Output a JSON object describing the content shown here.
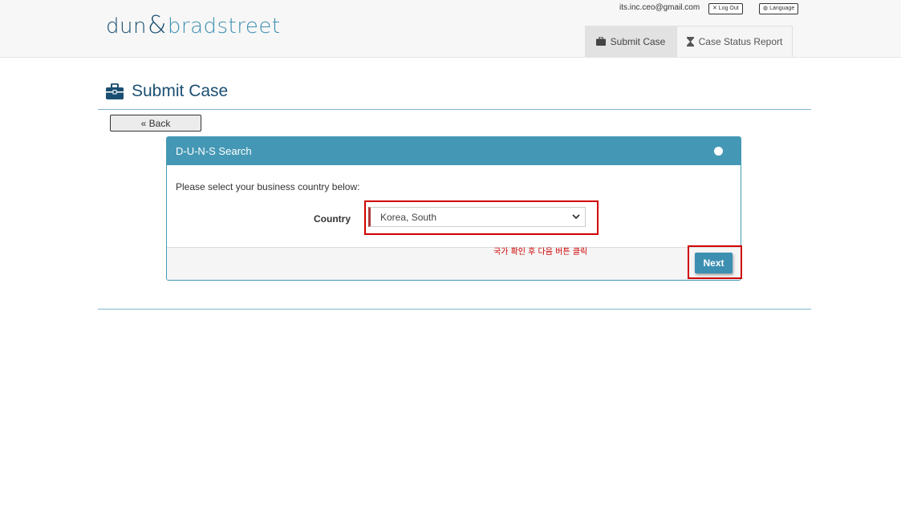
{
  "header": {
    "logo_dun": "dun",
    "logo_amp": "&",
    "logo_bradstreet": "bradstreet",
    "user_email": "its.inc.ceo@gmail.com",
    "logout_label": "✕ Log Out",
    "language_label": "Language",
    "tabs": [
      {
        "label": "Submit Case",
        "icon": "briefcase-icon",
        "active": true
      },
      {
        "label": "Case Status Report",
        "icon": "hourglass-icon",
        "active": false
      }
    ]
  },
  "page": {
    "title": "Submit Case",
    "back_label": "« Back"
  },
  "panel": {
    "title": "D-U-N-S Search",
    "prompt": "Please select your business country below:",
    "country_label": "Country",
    "country_value": "Korea, South",
    "next_label": "Next"
  },
  "annotation": {
    "text": "국가 확인 후 다음 버튼 클릭",
    "color": "#d00000"
  },
  "colors": {
    "brand_dark": "#1b4f72",
    "brand_accent": "#4598b5"
  }
}
